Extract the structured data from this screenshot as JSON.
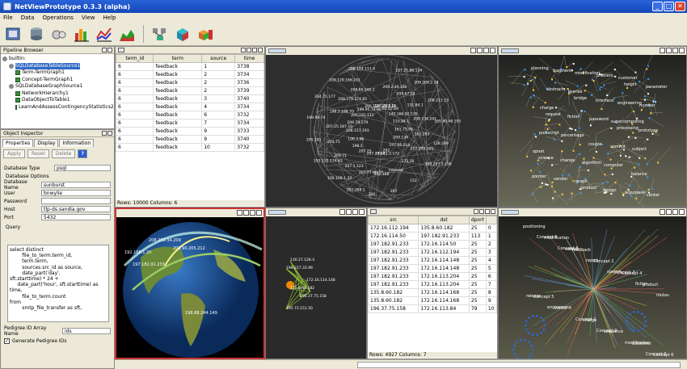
{
  "window": {
    "title": "NetViewPrototype 0.3.3 (alpha)"
  },
  "menu": [
    "File",
    "Data",
    "Operations",
    "View",
    "Help"
  ],
  "pipeline": {
    "title": "Pipeline Browser",
    "items": [
      "builtin:",
      "SQLDatabaseTableSource1",
      "Term-TermGraph1",
      "Concept-TermGraph1",
      "SQLDatabaseGraphSource1",
      "NetworkHierarchy1",
      "DataObjectToTable1",
      "LearnAndAssessContingencyStatistics2"
    ]
  },
  "inspector": {
    "title": "Object Inspector",
    "tabs": [
      "Properties",
      "Display",
      "Information"
    ],
    "buttons": {
      "apply": "Apply",
      "reset": "Reset",
      "delete": "Delete",
      "help": "?"
    },
    "db_type_label": "Database Type",
    "db_type_value": "psql",
    "db_options_label": "Database Options",
    "fields": [
      {
        "label": "Database Name",
        "value": "sunburst"
      },
      {
        "label": "User",
        "value": "bnwylie"
      },
      {
        "label": "Password",
        "value": ""
      },
      {
        "label": "Host",
        "value": "tlp-ds.sandia.gov"
      },
      {
        "label": "Port",
        "value": "5432"
      }
    ],
    "query_label": "Query",
    "query_text": "select distinct\n        file_to_term.term_id,\n        term.term,\n        sources.src_id as source,\n        date_part('day',\nsft.starttime) * 24 +\n     date_part('hour', sft.starttime) as\ntime,\n        file_to_term.count\nfrom\n        smtp_file_transfer as sft,",
    "pedigree_label": "Pedigree ID Array Name",
    "pedigree_value": "ids",
    "generate_label": "Generate Pedigree IDs"
  },
  "table1": {
    "columns": [
      "term_id",
      "term",
      "source",
      "time"
    ],
    "rows": [
      [
        "6",
        "feedback",
        "1",
        "3738"
      ],
      [
        "6",
        "feedback",
        "2",
        "3734"
      ],
      [
        "6",
        "feedback",
        "2",
        "3736"
      ],
      [
        "6",
        "feedback",
        "2",
        "3739"
      ],
      [
        "6",
        "feedback",
        "3",
        "3740"
      ],
      [
        "6",
        "feedback",
        "4",
        "3734"
      ],
      [
        "6",
        "feedback",
        "6",
        "3732"
      ],
      [
        "6",
        "feedback",
        "7",
        "3734"
      ],
      [
        "6",
        "feedback",
        "9",
        "3733"
      ],
      [
        "6",
        "feedback",
        "9",
        "3740"
      ],
      [
        "6",
        "feedback",
        "10",
        "3732"
      ]
    ],
    "status": "Rows: 10000  Columns: 6"
  },
  "table2": {
    "columns": [
      "src",
      "dst",
      "dport"
    ],
    "rows": [
      [
        "172.16.112.194",
        "135.8.60.182",
        "25",
        "0"
      ],
      [
        "172.16.114.50",
        "197.182.91.233",
        "113",
        "1"
      ],
      [
        "197.182.91.233",
        "172.16.114.50",
        "25",
        "2"
      ],
      [
        "197.182.91.233",
        "172.16.112.194",
        "25",
        "3"
      ],
      [
        "197.182.91.233",
        "172.16.114.148",
        "25",
        "4"
      ],
      [
        "197.182.91.233",
        "172.16.114.148",
        "25",
        "5"
      ],
      [
        "197.182.91.233",
        "172.16.113.204",
        "25",
        "6"
      ],
      [
        "197.182.91.233",
        "172.16.113.204",
        "25",
        "7"
      ],
      [
        "135.8.60.182",
        "172.16.114.168",
        "25",
        "8"
      ],
      [
        "135.8.60.182",
        "172.16.114.168",
        "25",
        "9"
      ],
      [
        "196.37.75.158",
        "172.16.113.84",
        "79",
        "10"
      ]
    ],
    "status": "Rows: 4927  Columns: 7"
  },
  "radial_labels": [
    "127.25.1.26",
    "209.2.46.180",
    "137.25.88.134",
    "62.52.69",
    "209.67.19",
    "209.209.2.24",
    "142.166.92.135",
    "131.84.1",
    "208.213.15",
    "133.84.1",
    "209.134.241",
    "165.90.48.105",
    "161.75.93",
    "192.163",
    "128.209",
    "209.134",
    "207.203.105",
    "199.207.1.238",
    "197.16.114",
    "172.16",
    "152",
    "202",
    "Internet",
    "207",
    "192.41.3.172",
    "192.168",
    "206",
    "207.27.90",
    "207.77.90.77",
    "192.168.1",
    "207.25",
    "207.1.123",
    "192.168.1.20",
    "198.2",
    "209.71",
    "193.135.174.63",
    "196.3.98",
    "204.71",
    "205.181",
    "208.157.193",
    "207.25.187.10",
    "199.99.74",
    "209.79.179",
    "198.3.198.70",
    "204.71.177",
    "205.181.112",
    "208.175.174.85",
    "209.129.166.101",
    "199.95.74.90",
    "208.66.240.2",
    "208.184.111.4",
    "205.188.247.111"
  ],
  "mini_labels": [
    "130.27.128.4",
    "199.227.33.99",
    "172.16.114.148",
    "135.8.60.182",
    "196.37.75.158",
    "195.73.151.50"
  ],
  "globe_labels": [
    "208.209.34.209",
    "192.168.1.20",
    "209.90.205.212",
    "197.182.91.233",
    "198.88.244.149"
  ],
  "word_cloud": [
    "planning",
    "bridge",
    "processing",
    "science",
    "product",
    "height",
    "request",
    "couple",
    "balance",
    "fragment",
    "interface",
    "prototype",
    "change",
    "design",
    "parameter",
    "fiction",
    "commit",
    "pointer",
    "modification",
    "engineering",
    "postscript",
    "algorithm",
    "argument",
    "abstract",
    "password",
    "subject",
    "vendor",
    "problem",
    "number",
    "percentage",
    "computer",
    "center",
    "license",
    "supercomputing",
    "opnet",
    "graph",
    "customer",
    "charge"
  ],
  "concept_labels": [
    "positioning",
    "feedback",
    "Concept 4",
    "Concept 5",
    "charge",
    "customer",
    "modification",
    "Concept 2",
    "product",
    "vector",
    "sequence",
    "Concept 6",
    "version",
    "Concept 7",
    "release",
    "Concept 1",
    "modification",
    "Concept 3",
    "report",
    "fiction",
    "engineering",
    "Concept 9",
    "Concept 0",
    "Concept 8",
    "speech",
    "routes"
  ]
}
